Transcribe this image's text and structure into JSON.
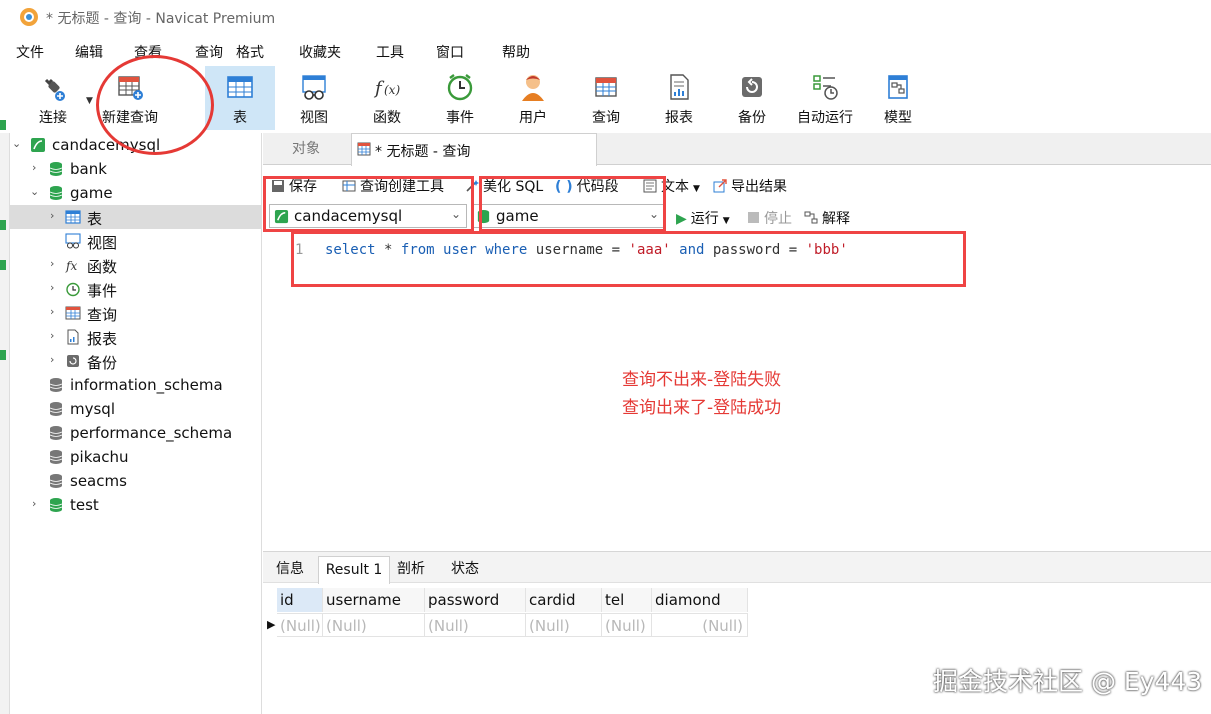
{
  "window": {
    "title": "* 无标题 - 查询 - Navicat Premium"
  },
  "menu": [
    "文件",
    "编辑",
    "查看",
    "查询",
    "格式",
    "收藏夹",
    "工具",
    "窗口",
    "帮助"
  ],
  "toolbar": [
    {
      "label": "连接",
      "icon": "plug-icon"
    },
    {
      "label": "新建查询",
      "icon": "new-query-icon"
    },
    {
      "label": "表",
      "icon": "table-icon",
      "active": true
    },
    {
      "label": "视图",
      "icon": "view-icon"
    },
    {
      "label": "函数",
      "icon": "function-icon"
    },
    {
      "label": "事件",
      "icon": "clock-icon"
    },
    {
      "label": "用户",
      "icon": "user-icon"
    },
    {
      "label": "查询",
      "icon": "query-icon"
    },
    {
      "label": "报表",
      "icon": "report-icon"
    },
    {
      "label": "备份",
      "icon": "backup-icon"
    },
    {
      "label": "自动运行",
      "icon": "automation-icon"
    },
    {
      "label": "模型",
      "icon": "model-icon"
    }
  ],
  "tree": {
    "connection": "candacemysql",
    "databases": [
      "bank",
      "game",
      "information_schema",
      "mysql",
      "performance_schema",
      "pikachu",
      "seacms",
      "test"
    ],
    "game_children": [
      "表",
      "视图",
      "函数",
      "事件",
      "查询",
      "报表",
      "备份"
    ]
  },
  "tabs": {
    "objects": "对象",
    "query": "* 无标题 - 查询"
  },
  "query_toolbar": {
    "save": "保存",
    "builder": "查询创建工具",
    "beautify": "美化 SQL",
    "snippet": "代码段",
    "text": "文本",
    "export": "导出结果",
    "connection": "candacemysql",
    "database": "game",
    "run": "运行",
    "stop": "停止",
    "explain": "解释"
  },
  "editor": {
    "line_number": "1",
    "sql": "select * from user where username = 'aaa' and password = 'bbb'"
  },
  "annotation": {
    "line1": "查询不出来-登陆失败",
    "line2": "查询出来了-登陆成功"
  },
  "result_tabs": [
    "信息",
    "Result 1",
    "剖析",
    "状态"
  ],
  "grid": {
    "columns": [
      "id",
      "username",
      "password",
      "cardid",
      "tel",
      "diamond"
    ],
    "row": [
      "(Null)",
      "(Null)",
      "(Null)",
      "(Null)",
      "(Null)",
      "(Null)"
    ]
  },
  "watermark": "掘金技术社区 @ Ey443",
  "colors": {
    "accent_red": "#e53935",
    "keyword": "#1a5fb4",
    "string": "#c01c28",
    "active_tool": "#cfe6f7"
  }
}
